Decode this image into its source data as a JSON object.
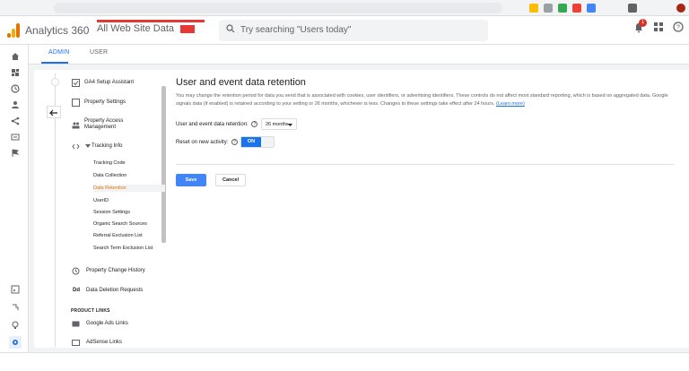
{
  "header": {
    "app_title": "Analytics 360",
    "account_name": "All Web Site Data",
    "search_placeholder": "Try searching \"Users today\"",
    "notification_count": "1"
  },
  "tabs": [
    {
      "label": "ADMIN"
    },
    {
      "label": "USER"
    }
  ],
  "nav": {
    "items": [
      {
        "label": "GA4 Setup Assistant"
      },
      {
        "label": "Property Settings"
      },
      {
        "label": "Property Access Management"
      },
      {
        "label": "Tracking Info"
      }
    ],
    "sub_items": [
      {
        "label": "Tracking Code"
      },
      {
        "label": "Data Collection"
      },
      {
        "label": "Data Retention"
      },
      {
        "label": "UserID"
      },
      {
        "label": "Session Settings"
      },
      {
        "label": "Organic Search Sources"
      },
      {
        "label": "Referral Exclusion List"
      },
      {
        "label": "Search Term Exclusion List"
      }
    ],
    "items2": [
      {
        "label": "Property Change History"
      },
      {
        "label": "Data Deletion Requests"
      }
    ],
    "dd_label": "Dd",
    "section_label": "PRODUCT LINKS",
    "product_links": [
      {
        "label": "Google Ads Links"
      },
      {
        "label": "AdSense Links"
      }
    ]
  },
  "main": {
    "title": "User and event data retention",
    "description": "You may change the retention period for data you send that is associated with cookies, user identifiers, or advertising identifiers. These controls do not affect most standard reporting, which is based on aggregated data. Google signals data (if enabled) is retained according to your setting or 26 months, whichever is less. Changes to these settings take effect after 24 hours.",
    "learn_more": "(Learn more)",
    "retention_label": "User and event data retention:",
    "retention_value": "26 months",
    "reset_label": "Reset on new activity:",
    "reset_value": "ON",
    "save_label": "Save",
    "cancel_label": "Cancel"
  },
  "colors": {
    "accent": "#1a73e8",
    "selected_nav": "#e37400",
    "save_button": "#4285f4"
  }
}
